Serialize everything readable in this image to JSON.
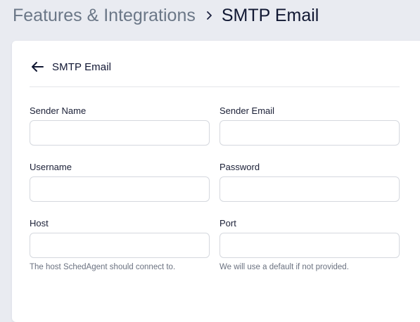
{
  "breadcrumb": {
    "parent": "Features & Integrations",
    "current": "SMTP Email",
    "separator_icon": "chevron-right-icon"
  },
  "card": {
    "title": "SMTP Email",
    "back_icon": "arrow-left-icon"
  },
  "form": {
    "sender_name": {
      "label": "Sender Name",
      "value": "",
      "placeholder": ""
    },
    "sender_email": {
      "label": "Sender Email",
      "value": "",
      "placeholder": ""
    },
    "username": {
      "label": "Username",
      "value": "",
      "placeholder": ""
    },
    "password": {
      "label": "Password",
      "value": "",
      "placeholder": ""
    },
    "host": {
      "label": "Host",
      "value": "",
      "placeholder": "",
      "help": "The host SchedAgent should connect to."
    },
    "port": {
      "label": "Port",
      "value": "",
      "placeholder": "",
      "help": "We will use a default if not provided."
    }
  },
  "colors": {
    "page_background": "#e9ebf1",
    "card_background": "#ffffff",
    "heading_text": "#111833",
    "muted_text": "#6b7787",
    "input_border": "#d5d8de"
  }
}
